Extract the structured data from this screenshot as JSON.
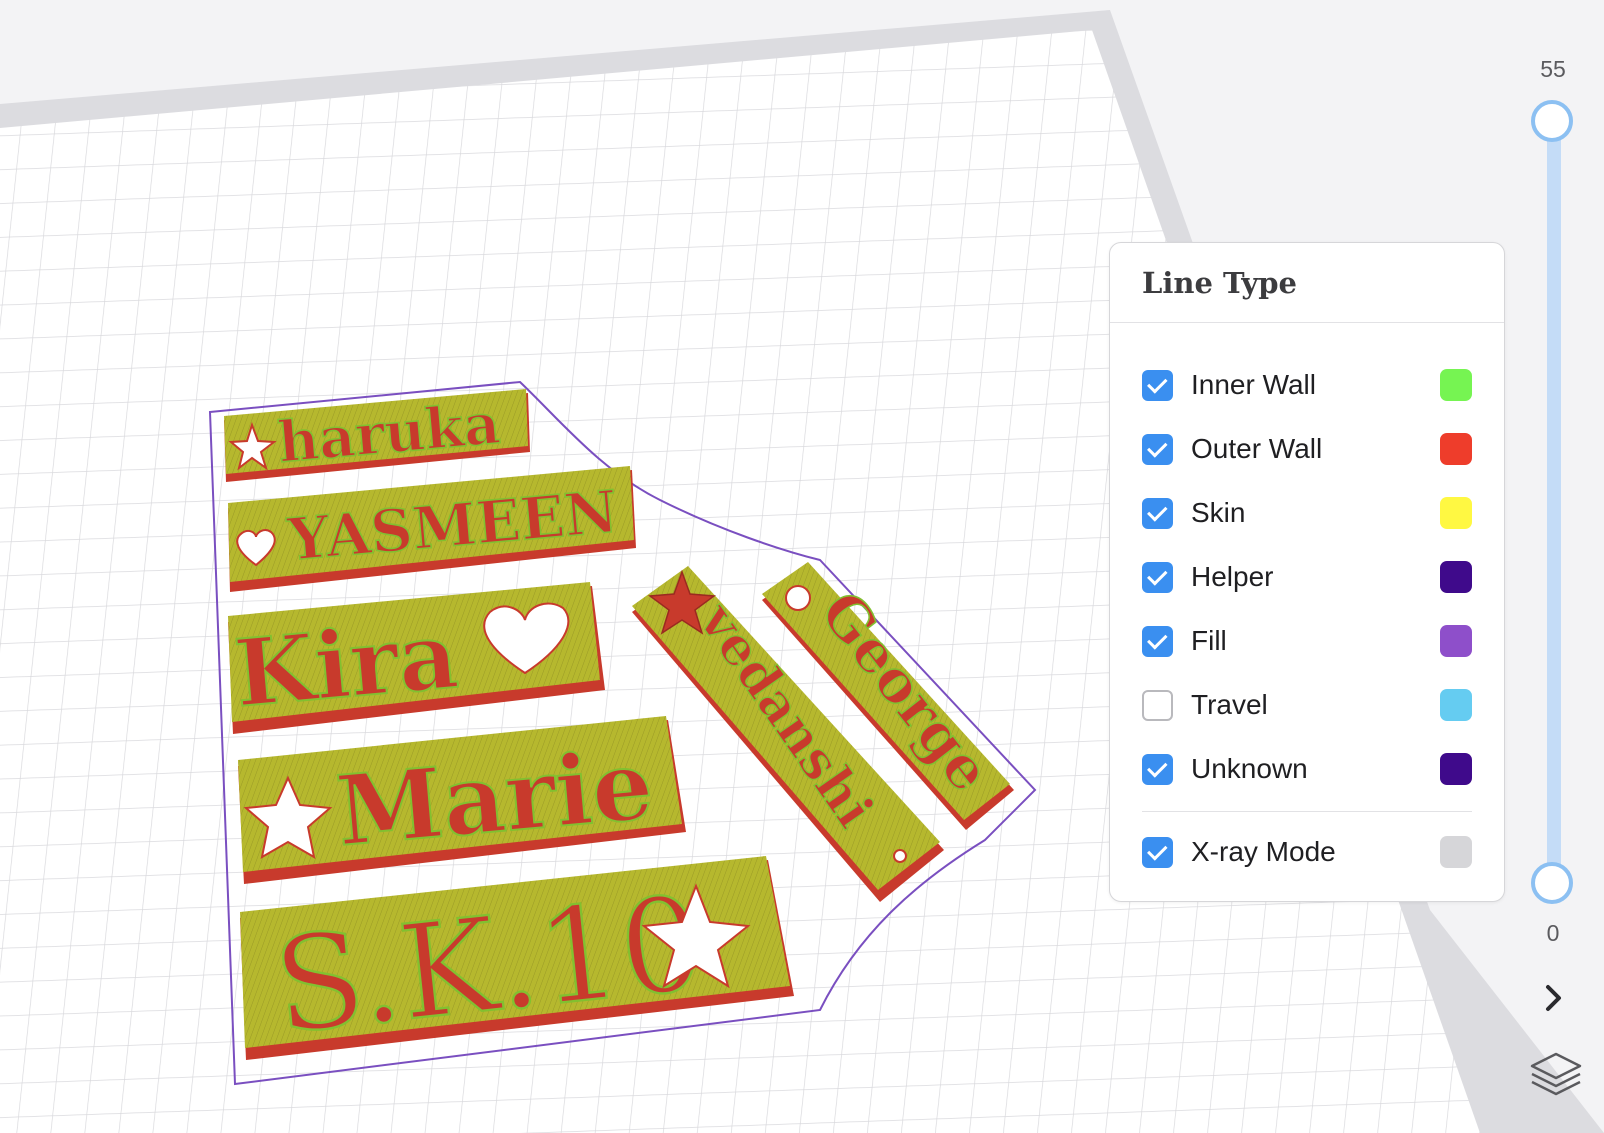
{
  "legend": {
    "title": "Line Type",
    "items": [
      {
        "label": "Inner Wall",
        "checked": true,
        "color": "#76f452"
      },
      {
        "label": "Outer Wall",
        "checked": true,
        "color": "#ee3d2b"
      },
      {
        "label": "Skin",
        "checked": true,
        "color": "#fff842"
      },
      {
        "label": "Helper",
        "checked": true,
        "color": "#3f0a8b"
      },
      {
        "label": "Fill",
        "checked": true,
        "color": "#8e4fca"
      },
      {
        "label": "Travel",
        "checked": false,
        "color": "#65ccf1"
      },
      {
        "label": "Unknown",
        "checked": true,
        "color": "#3f0a8b"
      }
    ],
    "xray": {
      "label": "X-ray Mode",
      "checked": true,
      "color": "#d6d6d9"
    }
  },
  "layer_slider": {
    "max_label": "55",
    "min_label": "0",
    "icons": {
      "next": "chevron-right-icon",
      "layers": "layers-icon"
    }
  },
  "print_objects": {
    "tags": [
      "haruka",
      "YASMEEN",
      "Kira",
      "Marie",
      "S.K.10",
      "vedanshi",
      "George"
    ],
    "colors": {
      "top_skin": "#b3b52c",
      "side_wall": "#c83a2c",
      "text_fill": "#82c030",
      "outline": "#7a4fc0",
      "bed_grid": "#d9d9dd",
      "bed_bg": "#ffffff"
    }
  }
}
